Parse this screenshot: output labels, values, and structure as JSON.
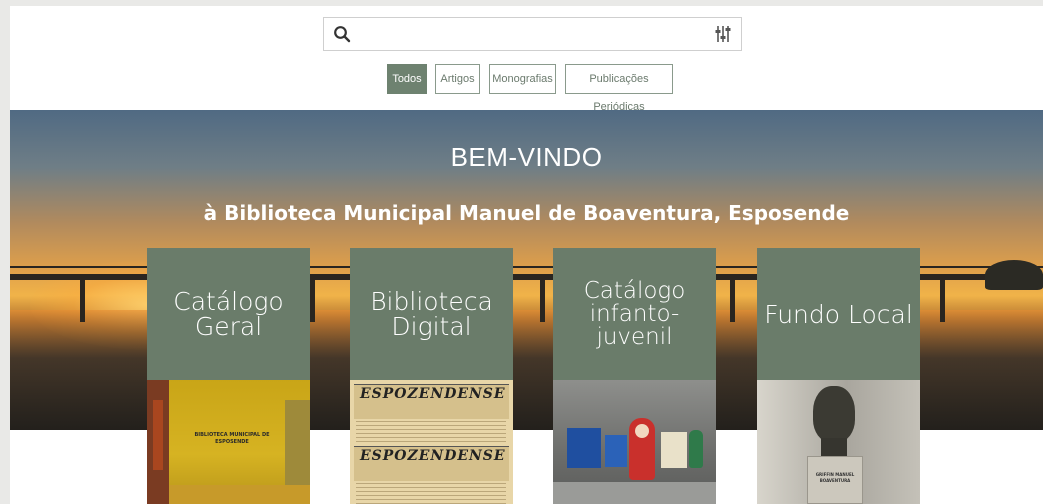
{
  "search": {
    "value": "",
    "placeholder": "",
    "search_icon": "search-icon",
    "filter_icon": "filter-sliders-icon"
  },
  "tabs": [
    {
      "label": "Todos",
      "active": true
    },
    {
      "label": "Artigos",
      "active": false
    },
    {
      "label": "Monografias",
      "active": false
    },
    {
      "label": "Publicações Periódicas",
      "active": false
    }
  ],
  "hero": {
    "title": "BEM-VINDO",
    "subtitle": "à Biblioteca Municipal Manuel de Boaventura, Esposende"
  },
  "cards": [
    {
      "label": "Catálogo\nGeral",
      "photo_text": "BIBLIOTECA MUNICIPAL DE ESPOSENDE"
    },
    {
      "label": "Biblioteca\nDigital",
      "photo_text": "ESPOZENDENSE"
    },
    {
      "label": "Catálogo\ninfanto-\njuvenil",
      "photo_text": ""
    },
    {
      "label": "Fundo Local",
      "photo_text": "GRIFFIN MANUEL BOAVENTURA"
    }
  ],
  "colors": {
    "accent": "#6e8270",
    "card_bg": "#6a7c6a",
    "page_bg": "#e9e9e7"
  }
}
